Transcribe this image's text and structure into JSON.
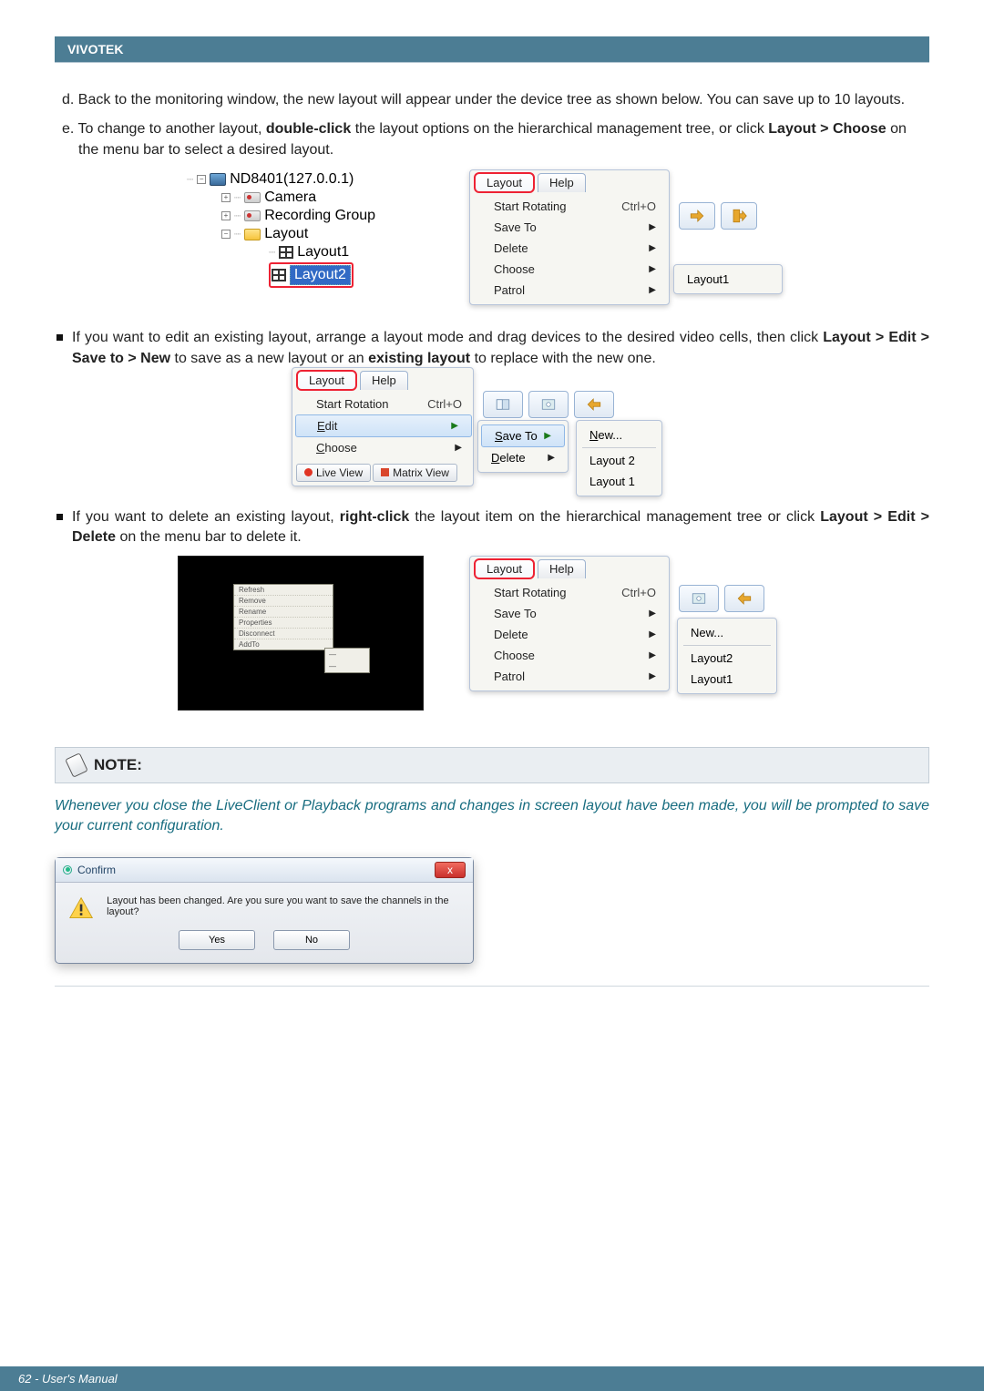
{
  "header": {
    "brand": "VIVOTEK"
  },
  "body": {
    "p_d": "d. Back to the monitoring window, the new layout will appear under the device tree as shown below. You can save up to 10 layouts.",
    "p_e_pre": "e. To change to another layout, ",
    "p_e_bold1": "double-click",
    "p_e_mid": " the layout options on the hierarchical management tree, or click ",
    "p_e_bold2": "Layout > Choose",
    "p_e_post": " on the menu bar to select a desired layout.",
    "p_edit_pre": "If you want to edit an existing layout, arrange a layout mode and drag devices to the desired video cells, then click ",
    "p_edit_bold": "Layout > Edit > Save to > New",
    "p_edit_mid": " to save as a new layout or an ",
    "p_edit_bold2": "existing layout",
    "p_edit_post": " to replace with the new one.",
    "p_del_pre": "If you want to delete an existing layout, ",
    "p_del_bold1": "right-click",
    "p_del_mid": " the layout item on the hierarchical management tree or click ",
    "p_del_bold2": "Layout > Edit > Delete",
    "p_del_post": " on the menu bar to delete it.",
    "note_title": "NOTE:",
    "note_body": "Whenever you close the LiveClient or Playback programs and changes in screen layout have been made, you will be prompted to save your current configuration."
  },
  "tree": {
    "root": "ND8401(127.0.0.1)",
    "camera": "Camera",
    "recgroup": "Recording Group",
    "layout": "Layout",
    "layout1": "Layout1",
    "layout2": "Layout2"
  },
  "menu1": {
    "tab_layout": "Layout",
    "tab_help": "Help",
    "start_rotating": "Start Rotating",
    "hot_start": "Ctrl+O",
    "save_to": "Save To",
    "delete": "Delete",
    "choose": "Choose",
    "patrol": "Patrol",
    "sub_layout1": "Layout1"
  },
  "menu2": {
    "tab_layout": "Layout",
    "tab_help": "Help",
    "start_rot": "Start Rotation",
    "hot": "Ctrl+O",
    "edit": "Edit",
    "choose": "Choose",
    "tab_live": "Live View",
    "tab_matrix": "Matrix View",
    "save_to": "Save To",
    "delete": "Delete",
    "new": "New...",
    "l2": "Layout 2",
    "l1": "Layout 1"
  },
  "ctx": {
    "a": "Refresh",
    "b": "Remove",
    "c": "Rename",
    "d": "Properties",
    "e": "Disconnect",
    "f": "AddTo"
  },
  "menu3": {
    "tab_layout": "Layout",
    "tab_help": "Help",
    "start_rotating": "Start Rotating",
    "hot_start": "Ctrl+O",
    "save_to": "Save To",
    "delete": "Delete",
    "choose": "Choose",
    "patrol": "Patrol",
    "new": "New...",
    "l2": "Layout2",
    "l1": "Layout1"
  },
  "dialog": {
    "title": "Confirm",
    "msg": "Layout has been changed. Are you sure you want to save the channels in the layout?",
    "yes": "Yes",
    "no": "No",
    "x": "x"
  },
  "footer": {
    "text": "62 - User's Manual"
  }
}
